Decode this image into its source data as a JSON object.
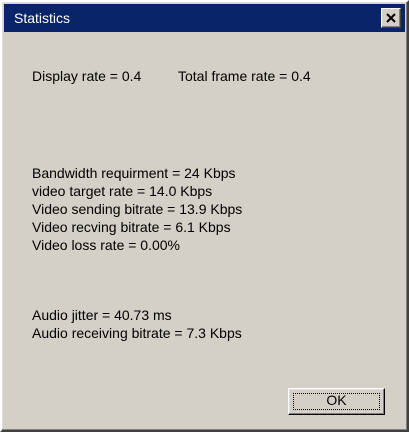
{
  "window": {
    "title": "Statistics",
    "close_icon": "close-icon"
  },
  "stats": {
    "display_rate": "Display rate = 0.4",
    "total_frame_rate": "Total frame rate = 0.4",
    "bandwidth_requirement": "Bandwidth requirment = 24 Kbps",
    "video_target_rate": "video target rate = 14.0 Kbps",
    "video_sending_bitrate": "Video sending bitrate = 13.9 Kbps",
    "video_recving_bitrate": "Video recving bitrate = 6.1 Kbps",
    "video_loss_rate": "Video loss rate = 0.00%",
    "audio_jitter": "Audio jitter = 40.73 ms",
    "audio_receiving_bitrate": "Audio receiving bitrate = 7.3 Kbps"
  },
  "buttons": {
    "ok_label": "OK"
  },
  "colors": {
    "titlebar": "#0a246a",
    "dialog_face": "#d4d0c8"
  }
}
